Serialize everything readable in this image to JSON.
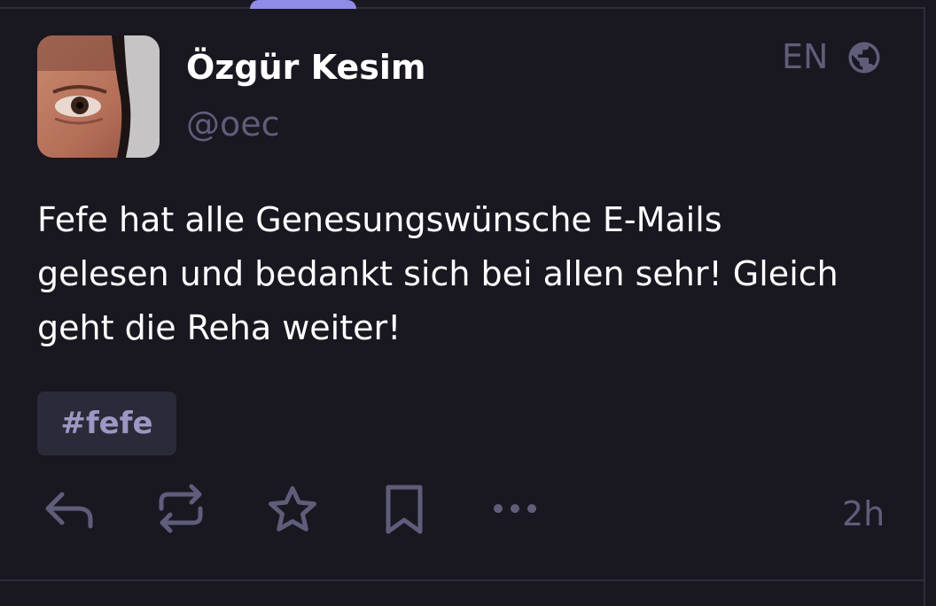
{
  "post": {
    "author": {
      "display_name": "Özgür Kesim",
      "handle": "@oec",
      "avatar": "avatar-photo"
    },
    "language": "EN",
    "visibility_icon": "globe-icon",
    "content_lines": [
      "Fefe hat alle Genesungswünsche E-Mails",
      "gelesen und bedankt sich bei allen sehr! Gleich",
      "geht die Reha weiter!"
    ],
    "hashtags": [
      "#fefe"
    ],
    "actions": [
      "reply-icon",
      "boost-icon",
      "favourite-icon",
      "bookmark-icon",
      "more-icon"
    ],
    "timestamp": "2h"
  },
  "colors": {
    "background": "#191821",
    "text": "#ffffff",
    "muted": "#5f5d7a",
    "accent": "#8f8ce7",
    "tag_bg": "#2b2a38"
  }
}
